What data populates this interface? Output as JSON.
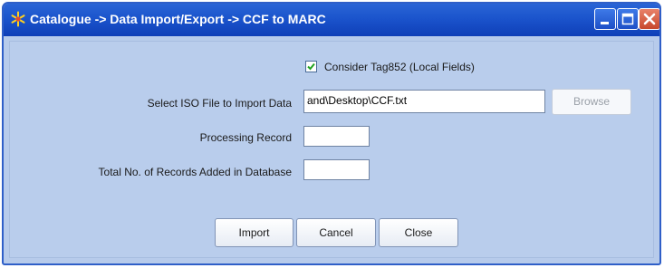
{
  "window": {
    "title": "Catalogue -> Data Import/Export -> CCF to MARC",
    "icon": "snowflake-icon"
  },
  "form": {
    "consider_tag_label": "Consider Tag852 (Local Fields)",
    "consider_tag_checked": true,
    "iso_file_label": "Select ISO File to Import Data",
    "iso_file_value": "and\\Desktop\\CCF.txt",
    "browse_label": "Browse",
    "processing_label": "Processing  Record",
    "processing_value": "",
    "total_label": "Total No. of Records Added in Database",
    "total_value": ""
  },
  "actions": {
    "import_label": "Import",
    "cancel_label": "Cancel",
    "close_label": "Close"
  },
  "colors": {
    "titlebar": "#1b54cc",
    "panel": "#b9cdec",
    "close_button": "#d9593b"
  }
}
